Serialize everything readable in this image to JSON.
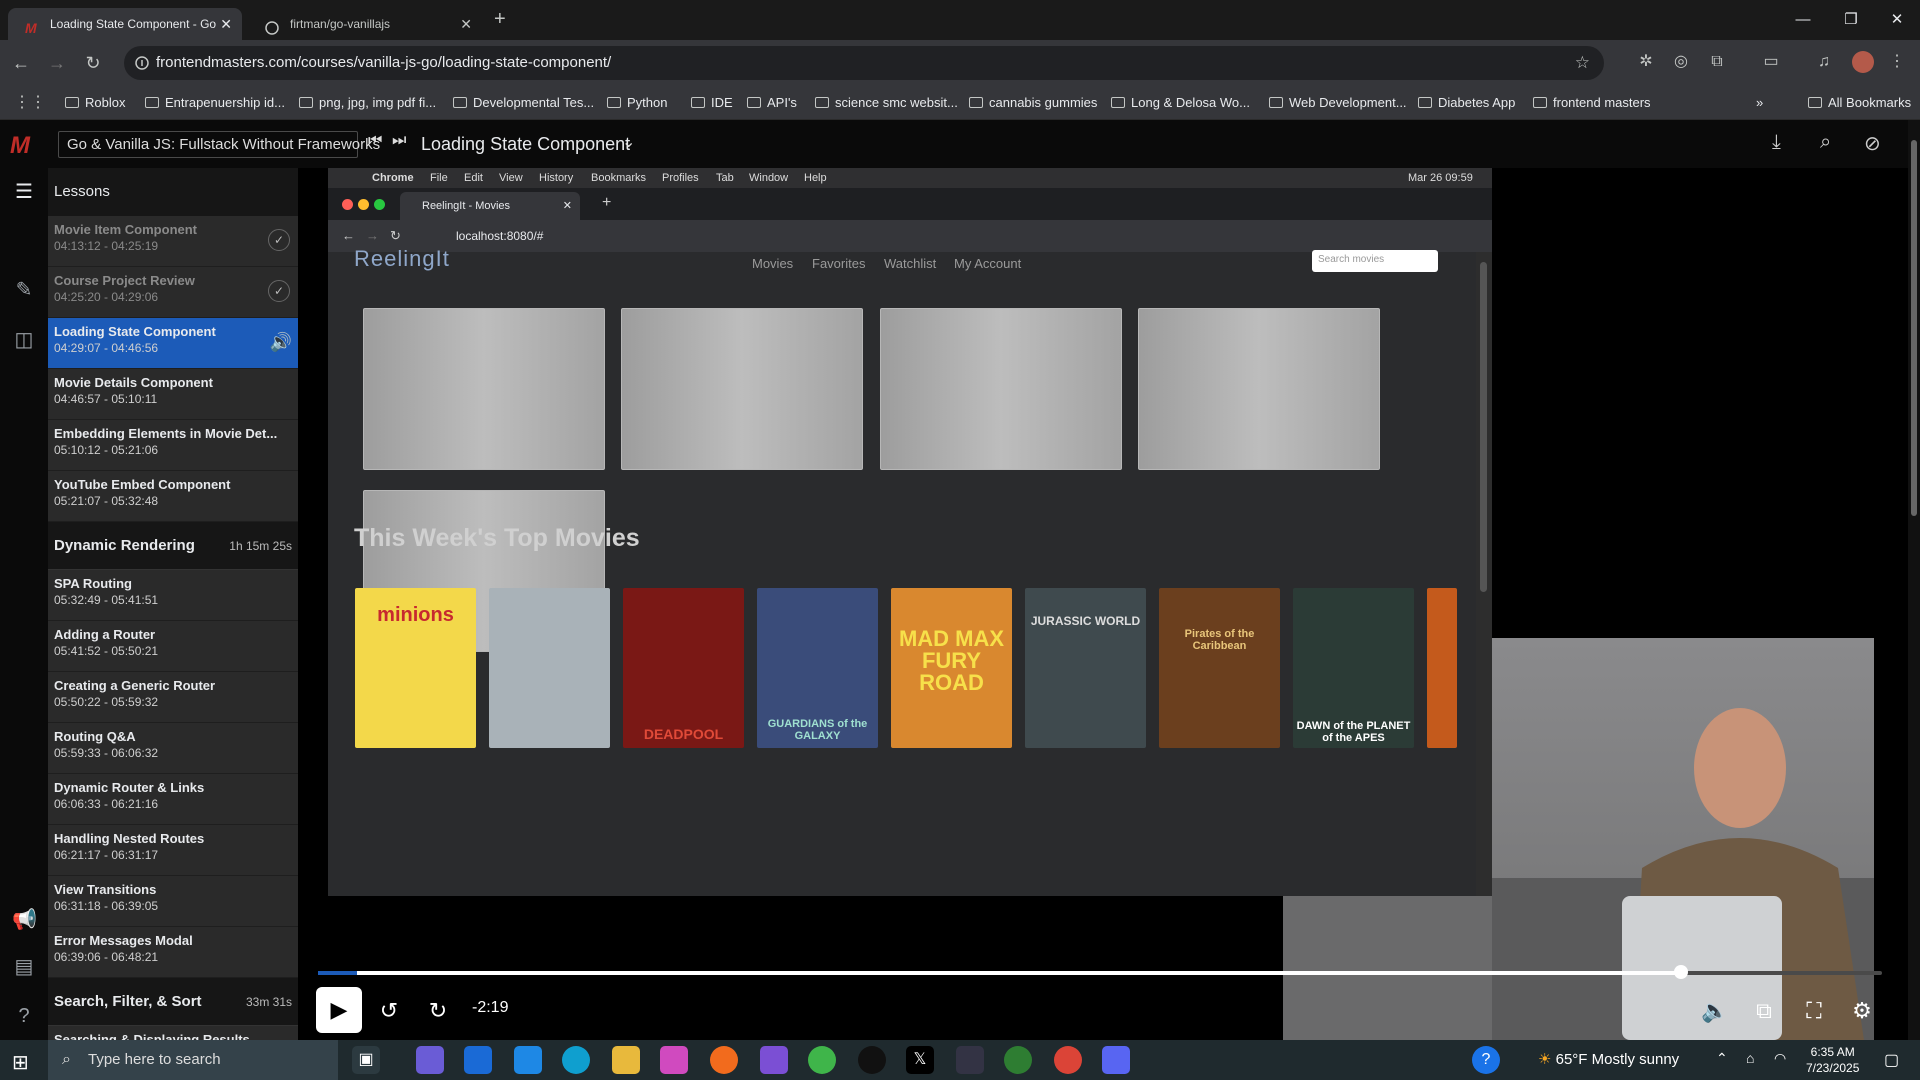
{
  "browser": {
    "tabs": [
      {
        "label": "Loading State Component - Go",
        "active": true
      },
      {
        "label": "firtman/go-vanillajs",
        "active": false
      }
    ],
    "url": "frontendmasters.com/courses/vanilla-js-go/loading-state-component/",
    "bookmarks": [
      "Roblox",
      "Entrapenuership id...",
      "png, jpg, img pdf fi...",
      "Developmental Tes...",
      "Python",
      "IDE",
      "API's",
      "science smc websit...",
      "cannabis gummies",
      "Long & Delosa Wo...",
      "Web Development...",
      "Diabetes App",
      "frontend masters"
    ],
    "all_bookmarks": "All Bookmarks"
  },
  "fm": {
    "logo": "M",
    "course_title": "Go & Vanilla JS: Fullstack Without Frameworks",
    "lesson_title": "Loading State Component"
  },
  "sidebar": {
    "header": "Lessons",
    "lessons_top": [
      {
        "title": "Movie Item Component",
        "time": "04:13:12 - 04:25:19",
        "state": "done"
      },
      {
        "title": "Course Project Review",
        "time": "04:25:20 - 04:29:06",
        "state": "done"
      },
      {
        "title": "Loading State Component",
        "time": "04:29:07 - 04:46:56",
        "state": "current"
      },
      {
        "title": "Movie Details Component",
        "time": "04:46:57 - 05:10:11",
        "state": "todo"
      },
      {
        "title": "Embedding Elements in Movie Det...",
        "time": "05:10:12 - 05:21:06",
        "state": "todo"
      },
      {
        "title": "YouTube Embed Component",
        "time": "05:21:07 - 05:32:48",
        "state": "todo"
      }
    ],
    "section1": {
      "title": "Dynamic Rendering",
      "duration": "1h 15m 25s"
    },
    "lessons_section1": [
      {
        "title": "SPA Routing",
        "time": "05:32:49 - 05:41:51"
      },
      {
        "title": "Adding a Router",
        "time": "05:41:52 - 05:50:21"
      },
      {
        "title": "Creating a Generic Router",
        "time": "05:50:22 - 05:59:32"
      },
      {
        "title": "Routing Q&A",
        "time": "05:59:33 - 06:06:32"
      },
      {
        "title": "Dynamic Router & Links",
        "time": "06:06:33 - 06:21:16"
      },
      {
        "title": "Handling Nested Routes",
        "time": "06:21:17 - 06:31:17"
      },
      {
        "title": "View Transitions",
        "time": "06:31:18 - 06:39:05"
      },
      {
        "title": "Error Messages Modal",
        "time": "06:39:06 - 06:48:21"
      }
    ],
    "section2": {
      "title": "Search, Filter, & Sort",
      "duration": "33m 31s"
    },
    "lessons_section2": [
      {
        "title": "Searching & Displaying Results",
        "time": ""
      }
    ]
  },
  "inner_screen": {
    "menubar": [
      "Chrome",
      "File",
      "Edit",
      "View",
      "History",
      "Bookmarks",
      "Profiles",
      "Tab",
      "Window",
      "Help"
    ],
    "clock": "Mar 26  09:59",
    "tab_title": "ReelingIt - Movies",
    "url": "localhost:8080/#",
    "site_logo": "ReelingIt",
    "nav": [
      "Movies",
      "Favorites",
      "Watchlist",
      "My Account"
    ],
    "search_placeholder": "Search movies",
    "section_title": "This Week's Top Movies",
    "posters": [
      {
        "title": "minions",
        "color": "#f3d84a"
      },
      {
        "title": "",
        "color": "#a9b2b8"
      },
      {
        "title": "DEADPOOL",
        "color": "#7a1815"
      },
      {
        "title": "GUARDIANS of the GALAXY",
        "color": "#3a4c7a"
      },
      {
        "title": "MAD MAX FURY ROAD",
        "color": "#d9882f"
      },
      {
        "title": "JURASSIC WORLD",
        "color": "#3f4a4e"
      },
      {
        "title": "Pirates of the Caribbean",
        "color": "#6b3f1e"
      },
      {
        "title": "DAWN of the PLANET of the APES",
        "color": "#2b3b36"
      },
      {
        "title": "",
        "color": "#c45a1c"
      }
    ]
  },
  "player": {
    "time_remaining": "-2:19",
    "progress": 0.87,
    "buffered": 0.025
  },
  "taskbar": {
    "search_placeholder": "Type here to search",
    "weather": "65°F  Mostly sunny",
    "time": "6:35 AM",
    "date": "7/23/2025"
  }
}
